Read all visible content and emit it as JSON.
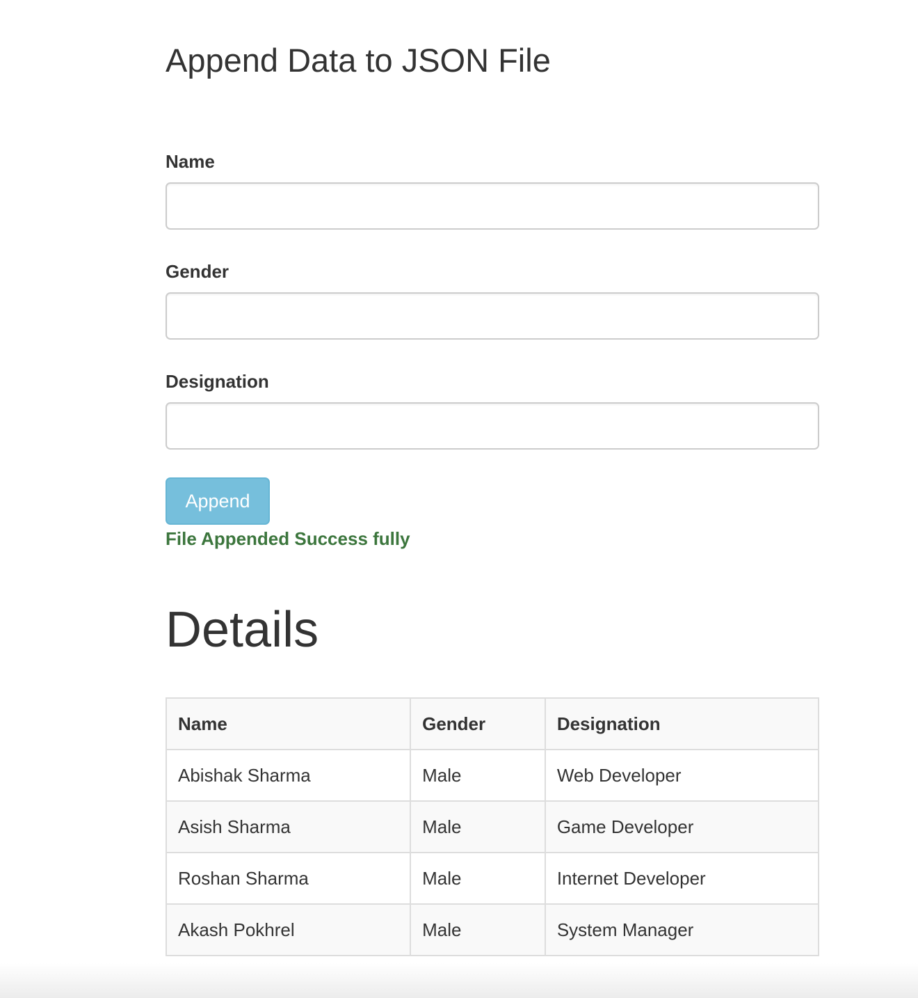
{
  "form": {
    "title": "Append Data to JSON File",
    "fields": {
      "name": {
        "label": "Name",
        "value": "",
        "placeholder": ""
      },
      "gender": {
        "label": "Gender",
        "value": "",
        "placeholder": ""
      },
      "designation": {
        "label": "Designation",
        "value": "",
        "placeholder": ""
      }
    },
    "submit_label": "Append",
    "status_message": "File Appended Success fully",
    "status_color": "#3c763d",
    "button_color": "#76bfdc"
  },
  "details": {
    "heading": "Details",
    "columns": [
      "Name",
      "Gender",
      "Designation"
    ],
    "rows": [
      [
        "Abishak Sharma",
        "Male",
        "Web Developer"
      ],
      [
        "Asish Sharma",
        "Male",
        "Game Developer"
      ],
      [
        "Roshan Sharma",
        "Male",
        "Internet Developer"
      ],
      [
        "Akash Pokhrel",
        "Male",
        "System Manager"
      ]
    ]
  }
}
